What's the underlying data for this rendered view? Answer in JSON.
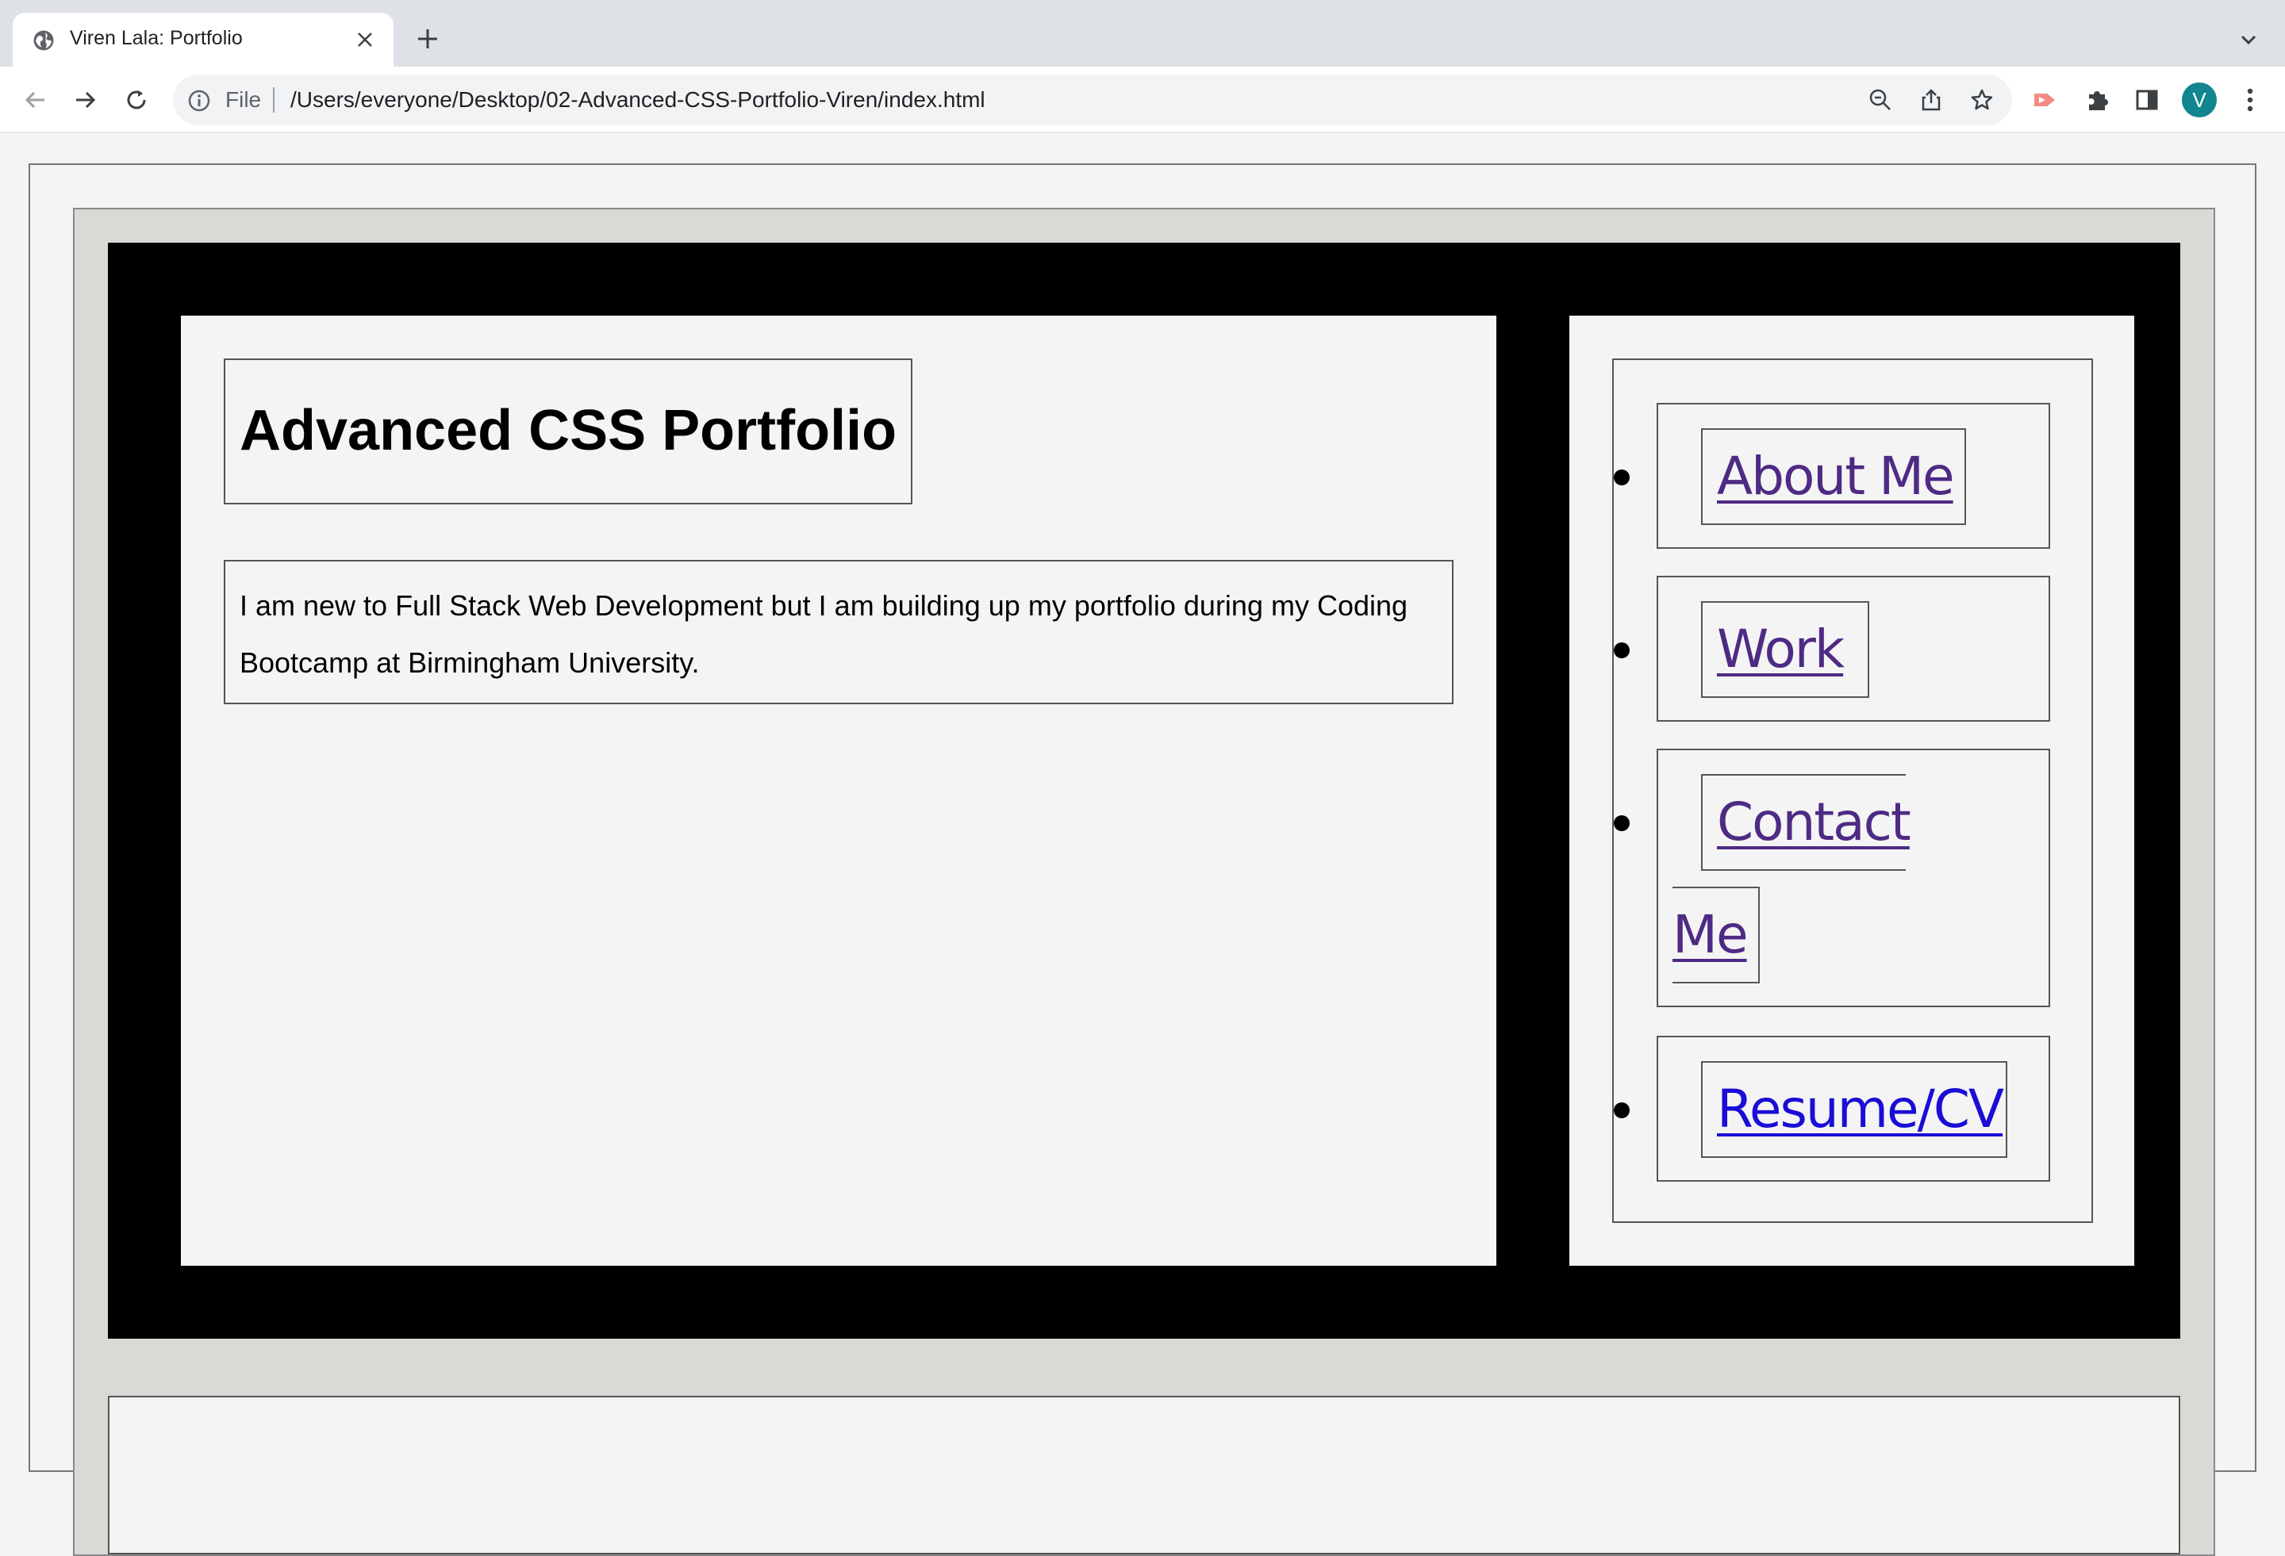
{
  "browser": {
    "tab_title": "Viren Lala: Portfolio",
    "url_scheme": "File",
    "url": "/Users/everyone/Desktop/02-Advanced-CSS-Portfolio-Viren/index.html",
    "profile_initial": "V"
  },
  "page": {
    "title": "Advanced CSS Portfolio",
    "intro": "I am new to Full Stack Web Development but I am building up my portfolio during my Coding Bootcamp at Birmingham University."
  },
  "nav": {
    "items": [
      {
        "label": "About Me"
      },
      {
        "label": "Work"
      },
      {
        "label_line1": "Contact",
        "label_line2": "Me"
      },
      {
        "label": "Resume/CV"
      }
    ]
  },
  "colors": {
    "visited_link": "#4e2a84",
    "unvisited_link": "#1a0dd6",
    "panel": "#000000",
    "wrapper": "#d9dad5"
  }
}
